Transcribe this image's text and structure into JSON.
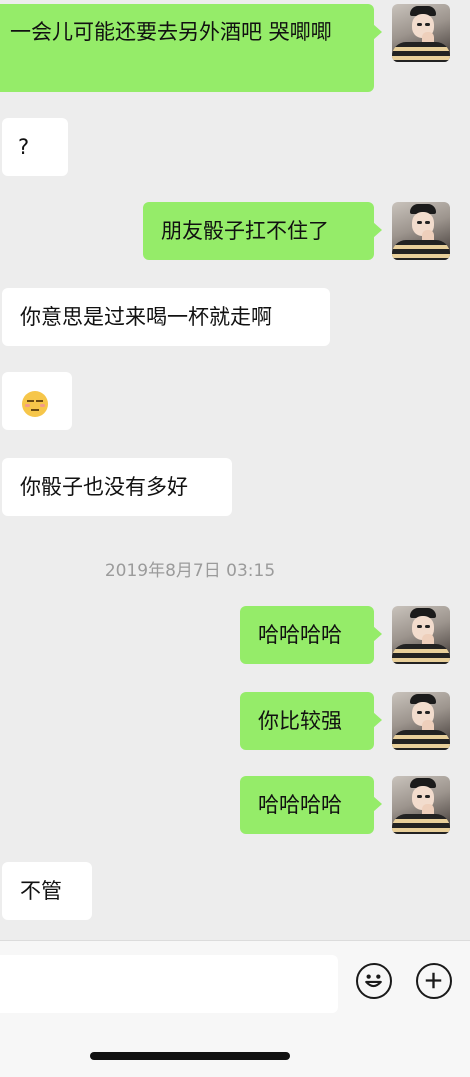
{
  "messages": [
    {
      "side": "sent",
      "text": "一会儿可能还要去另外酒吧 哭唧唧"
    },
    {
      "side": "recv",
      "text": "?"
    },
    {
      "side": "sent",
      "text": "朋友骰子扛不住了"
    },
    {
      "side": "recv",
      "text": "你意思是过来喝一杯就走啊"
    },
    {
      "side": "recv",
      "emoji": "unamused-face"
    },
    {
      "side": "recv",
      "text": "你骰子也没有多好"
    },
    {
      "side": "sent",
      "text": "哈哈哈哈"
    },
    {
      "side": "sent",
      "text": "你比较强"
    },
    {
      "side": "sent",
      "text": "哈哈哈哈"
    },
    {
      "side": "recv",
      "text": "不管"
    }
  ],
  "timestamp": "2019年8月7日 03:15",
  "input": {
    "placeholder": "",
    "value": ""
  },
  "toolbar": {
    "emoji_icon": "smiley-icon",
    "plus_icon": "plus-circle-icon"
  },
  "colors": {
    "sent_bubble": "#95ec69",
    "recv_bubble": "#ffffff",
    "background": "#ededed"
  }
}
